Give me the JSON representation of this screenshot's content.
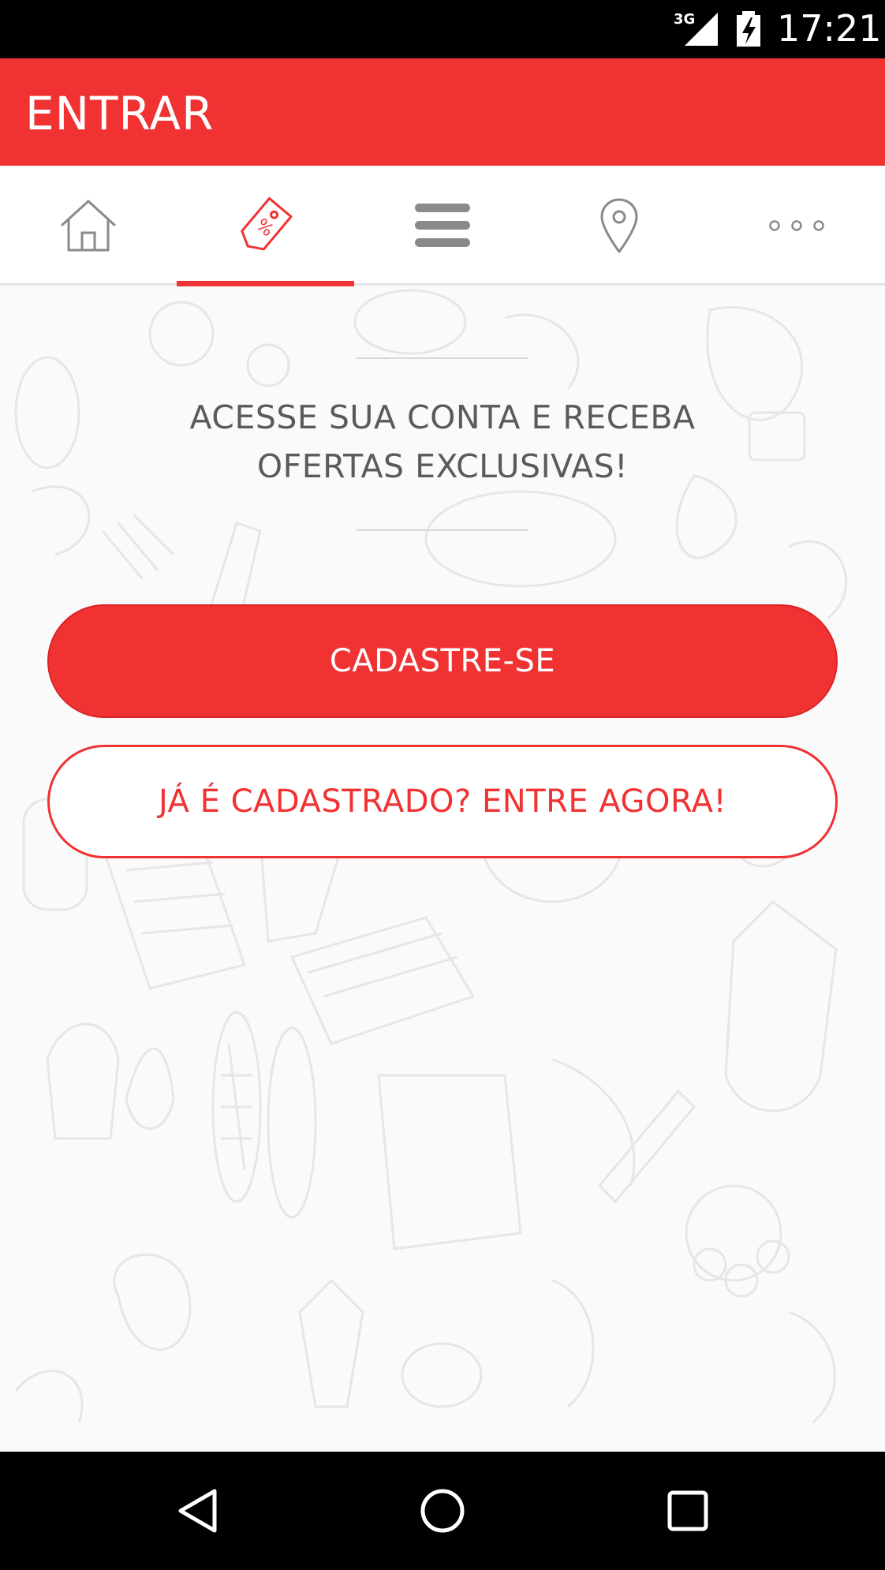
{
  "status_bar": {
    "network": "3G",
    "time": "17:21"
  },
  "toolbar": {
    "title": "ENTRAR"
  },
  "tabs": [
    {
      "icon": "home-icon",
      "selected": false
    },
    {
      "icon": "discount-tag-icon",
      "selected": true
    },
    {
      "icon": "menu-icon",
      "selected": false
    },
    {
      "icon": "location-pin-icon",
      "selected": false
    },
    {
      "icon": "more-icon",
      "selected": false
    }
  ],
  "colors": {
    "accent": "#f03233",
    "icon_inactive": "#8a8a8a",
    "text": "#5a5a5a"
  },
  "main": {
    "headline_line1": "ACESSE SUA CONTA E RECEBA",
    "headline_line2": "OFERTAS EXCLUSIVAS!",
    "register_button": "CADASTRE-SE",
    "login_button": "JÁ É CADASTRADO? ENTRE AGORA!"
  },
  "nav_bar": {
    "back": "back-icon",
    "home": "home-circle-icon",
    "recents": "recents-icon"
  }
}
